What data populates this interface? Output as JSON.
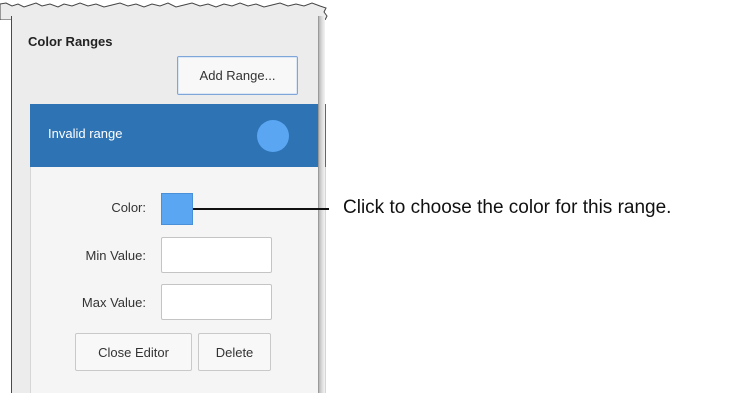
{
  "panel": {
    "title": "Color Ranges",
    "add_range_label": "Add Range..."
  },
  "range": {
    "name": "Invalid range",
    "color": "#5aa6f3",
    "header_color": "#2e74b5",
    "fields": {
      "color_label": "Color:",
      "min_label": "Min Value:",
      "min_value": "",
      "max_label": "Max Value:",
      "max_value": ""
    },
    "close_editor_label": "Close Editor",
    "delete_label": "Delete"
  },
  "callout": {
    "text": "Click to choose the color for this range."
  }
}
